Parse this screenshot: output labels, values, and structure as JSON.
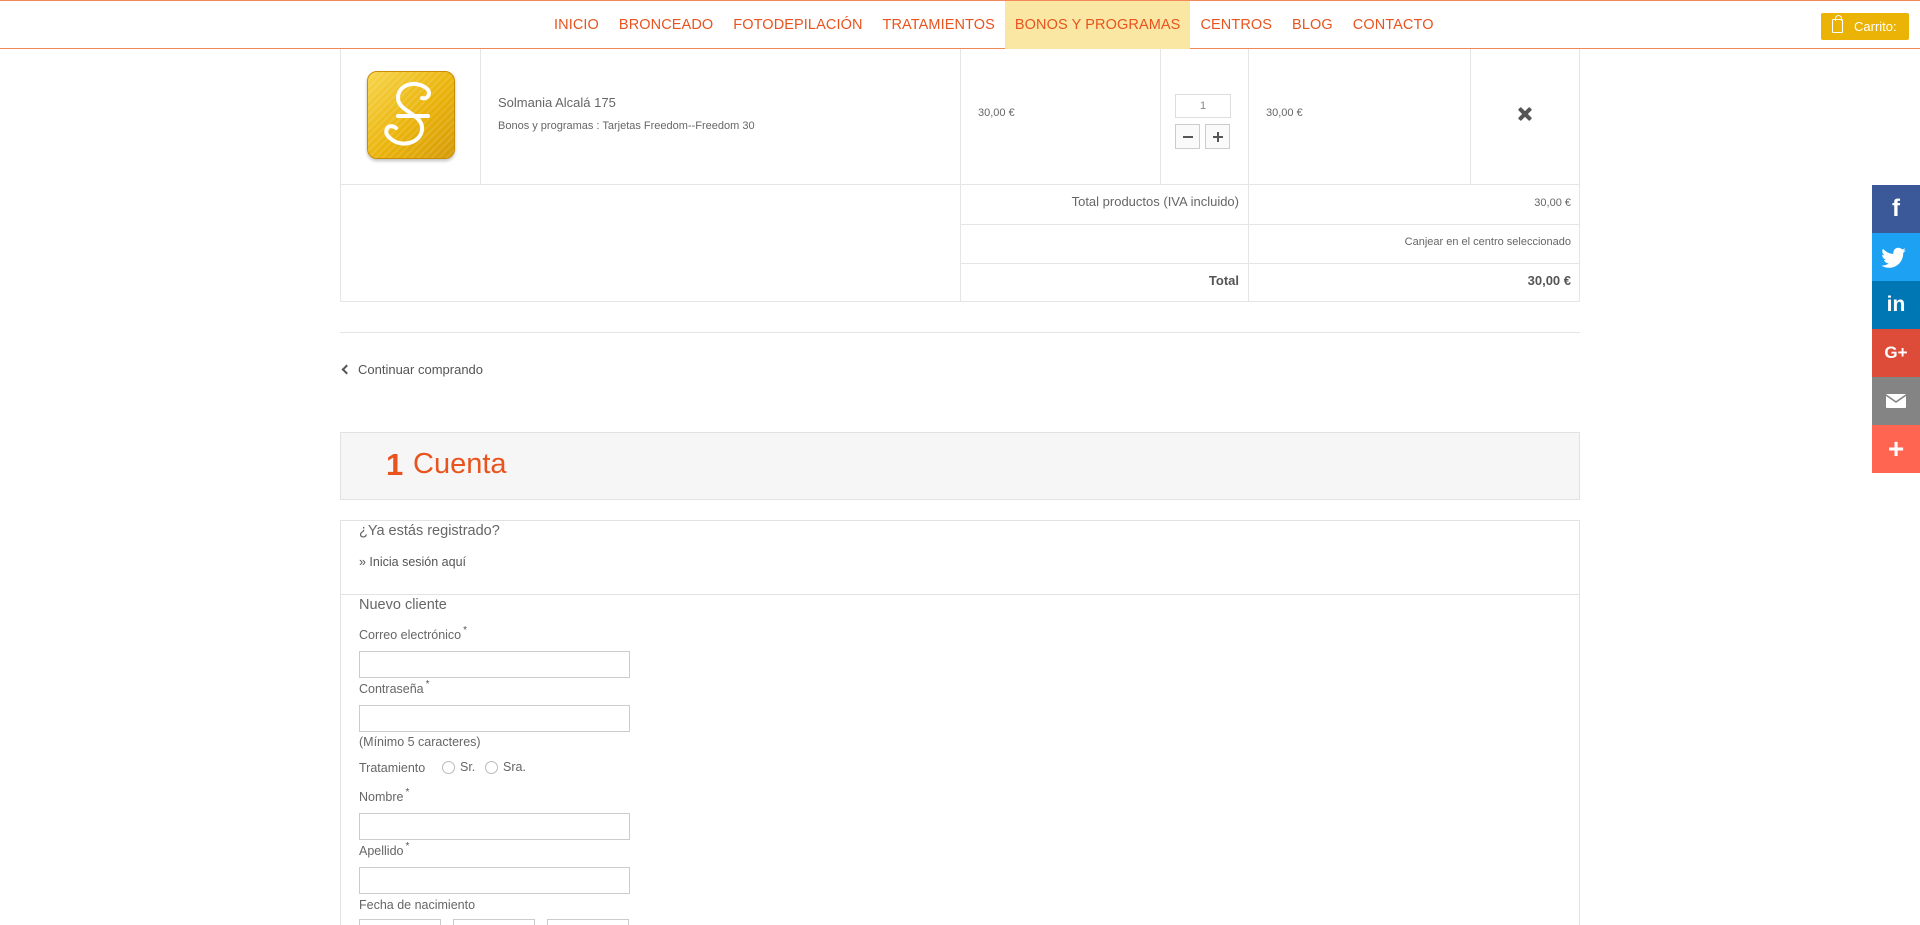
{
  "nav": {
    "items": [
      "INICIO",
      "BRONCEADO",
      "FOTODEPILACIÓN",
      "TRATAMIENTOS",
      "BONOS Y PROGRAMAS",
      "CENTROS",
      "BLOG",
      "CONTACTO"
    ],
    "active": "BONOS Y PROGRAMAS",
    "cart_label": "Carrito:"
  },
  "cart": {
    "product_name": "Solmania Alcalá 175",
    "product_attributes": "Bonos y programas : Tarjetas Freedom--Freedom 30",
    "unit_price": "30,00 €",
    "quantity": "1",
    "line_total": "30,00 €",
    "total_products_label": "Total productos (IVA incluido)",
    "total_products_value": "30,00 €",
    "shipping_note": "Canjear en el centro seleccionado",
    "total_label": "Total",
    "total_value": "30,00 €"
  },
  "continue_shopping": "Continuar comprando",
  "step": {
    "number": "1",
    "title": "Cuenta"
  },
  "account": {
    "registered_question": "¿Ya estás registrado?",
    "login_link": "» Inicia sesión aquí",
    "new_customer": "Nuevo cliente",
    "email_label": "Correo electrónico",
    "password_label": "Contraseña",
    "password_hint": "(Mínimo 5 caracteres)",
    "title_label": "Tratamiento",
    "title_options": [
      "Sr.",
      "Sra."
    ],
    "first_name_label": "Nombre",
    "last_name_label": "Apellido",
    "birthdate_label": "Fecha de nacimiento",
    "required_mark": "*"
  },
  "social": [
    {
      "name": "facebook",
      "glyph": "f",
      "color": "#3b5998"
    },
    {
      "name": "twitter",
      "glyph": "t",
      "color": "#1da1f2"
    },
    {
      "name": "linkedin",
      "glyph": "in",
      "color": "#0077b5"
    },
    {
      "name": "google-plus",
      "glyph": "G+",
      "color": "#dd4b39"
    },
    {
      "name": "email",
      "glyph": "",
      "color": "#848484"
    },
    {
      "name": "more",
      "glyph": "+",
      "color": "#ff6550"
    }
  ]
}
